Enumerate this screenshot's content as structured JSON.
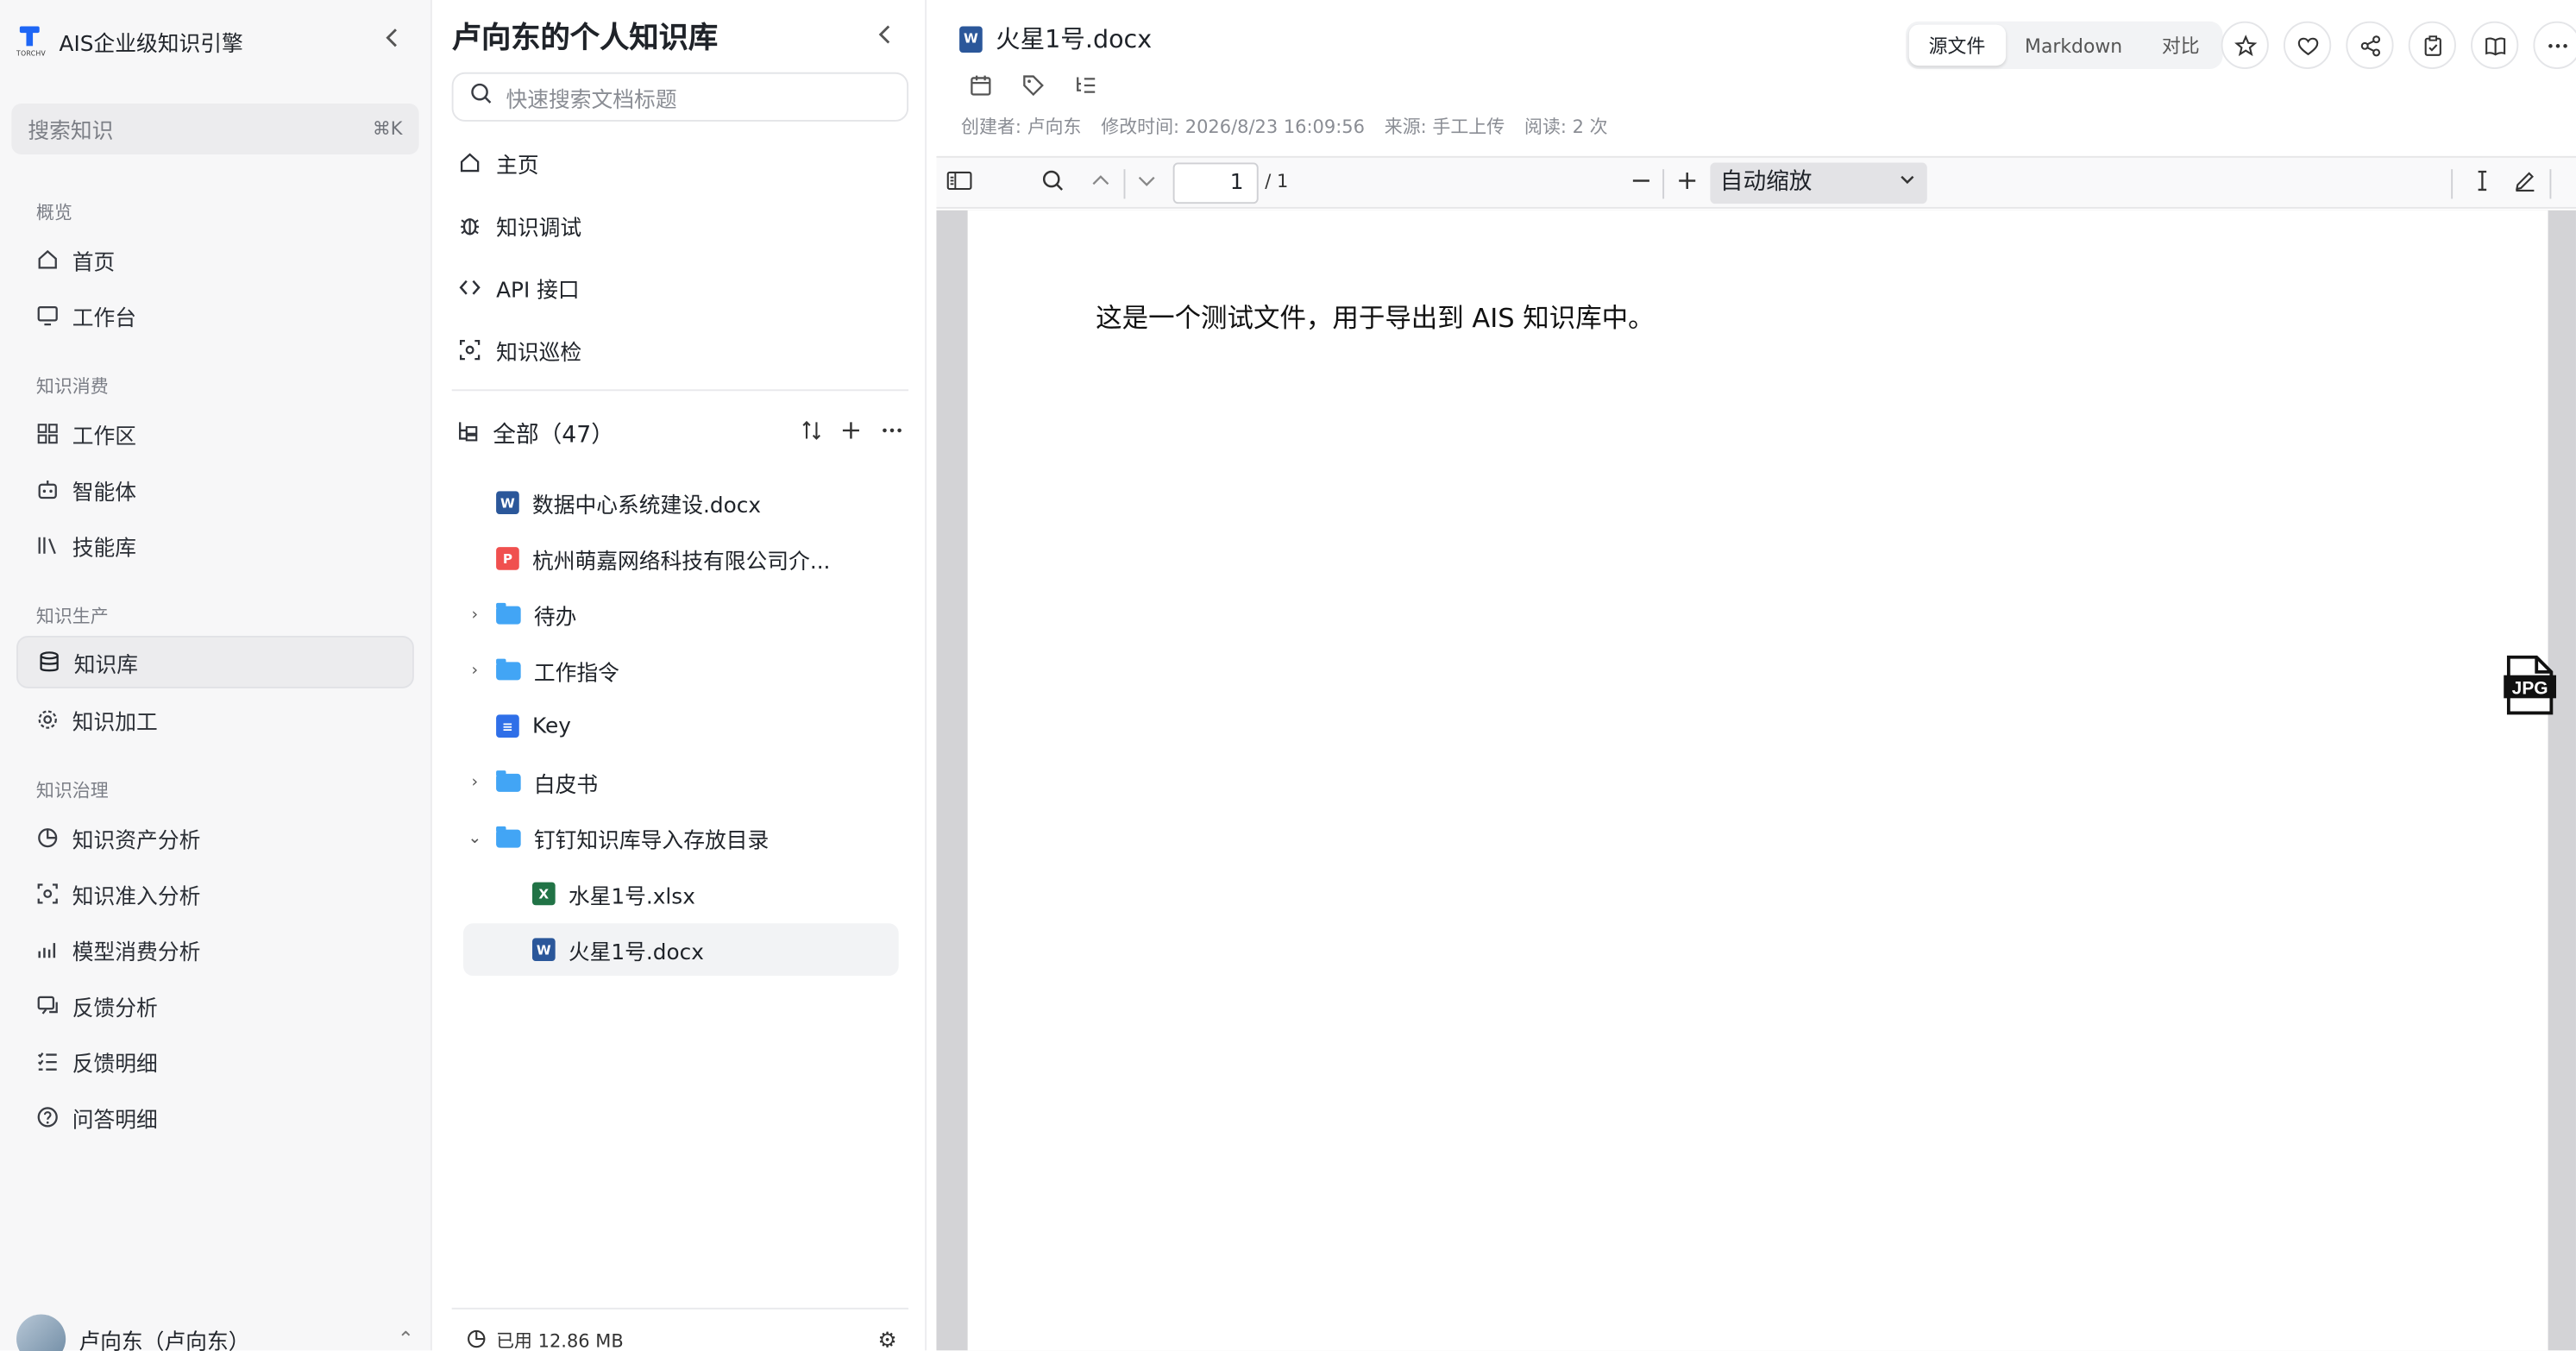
{
  "app": {
    "brand_title": "AIS企业级知识引擎",
    "brand_logo_text": "TORCHV"
  },
  "sidebar": {
    "search_placeholder": "搜索知识",
    "search_shortcut": "⌘K",
    "sections": [
      {
        "title": "概览",
        "items": [
          {
            "label": "首页",
            "icon": "home-icon"
          },
          {
            "label": "工作台",
            "icon": "monitor-icon"
          }
        ]
      },
      {
        "title": "知识消费",
        "items": [
          {
            "label": "工作区",
            "icon": "grid-icon"
          },
          {
            "label": "智能体",
            "icon": "robot-icon"
          },
          {
            "label": "技能库",
            "icon": "library-icon"
          }
        ]
      },
      {
        "title": "知识生产",
        "items": [
          {
            "label": "知识库",
            "icon": "database-icon",
            "active": true
          },
          {
            "label": "知识加工",
            "icon": "gear-icon"
          }
        ]
      },
      {
        "title": "知识治理",
        "items": [
          {
            "label": "知识资产分析",
            "icon": "pie-chart-icon"
          },
          {
            "label": "知识准入分析",
            "icon": "scan-icon"
          },
          {
            "label": "模型消费分析",
            "icon": "bar-chart-icon"
          },
          {
            "label": "反馈分析",
            "icon": "chat-icon"
          },
          {
            "label": "反馈明细",
            "icon": "checklist-icon"
          },
          {
            "label": "问答明细",
            "icon": "question-icon"
          }
        ]
      }
    ],
    "user_name": "卢向东（卢向东）"
  },
  "kb": {
    "title": "卢向东的个人知识库",
    "search_placeholder": "快速搜索文档标题",
    "menu": [
      {
        "label": "主页",
        "icon": "home-icon"
      },
      {
        "label": "知识调试",
        "icon": "bug-icon"
      },
      {
        "label": "API 接口",
        "icon": "code-icon"
      },
      {
        "label": "知识巡检",
        "icon": "scan-icon"
      }
    ],
    "tree_title": "全部（47）",
    "tree": [
      {
        "label": "数据中心系统建设.docx",
        "type": "word",
        "level": 0
      },
      {
        "label": "杭州萌嘉网络科技有限公司介...",
        "type": "pdf",
        "level": 0
      },
      {
        "label": "待办",
        "type": "folder",
        "level": 0,
        "expanded": false
      },
      {
        "label": "工作指令",
        "type": "folder",
        "level": 0,
        "expanded": false
      },
      {
        "label": "Key",
        "type": "note",
        "level": 0
      },
      {
        "label": "白皮书",
        "type": "folder",
        "level": 0,
        "expanded": false
      },
      {
        "label": "钉钉知识库导入存放目录",
        "type": "folder",
        "level": 0,
        "expanded": true
      },
      {
        "label": "水星1号.xlsx",
        "type": "excel",
        "level": 1
      },
      {
        "label": "火星1号.docx",
        "type": "word",
        "level": 1,
        "selected": true
      }
    ],
    "storage_used": "已用 12.86 MB"
  },
  "doc": {
    "title": "火星1号.docx",
    "meta": {
      "creator": "创建者: 卢向东",
      "modified": "修改时间: 2026/8/23 16:09:56",
      "source": "来源: 手工上传",
      "reads": "阅读: 2 次"
    },
    "view_tabs": [
      "源文件",
      "Markdown",
      "对比"
    ],
    "active_tab": "源文件",
    "viewer": {
      "page_current": "1",
      "page_total": "/ 1",
      "zoom": "自动缩放",
      "content": "这是一个测试文件，用于导出到 AIS 知识库中。",
      "badge_text": "JPG"
    }
  },
  "colors": {
    "accent": "#1e66f5",
    "word": "#2b579a",
    "excel": "#217346",
    "pdf": "#f0504f",
    "folder": "#42a5f5"
  }
}
